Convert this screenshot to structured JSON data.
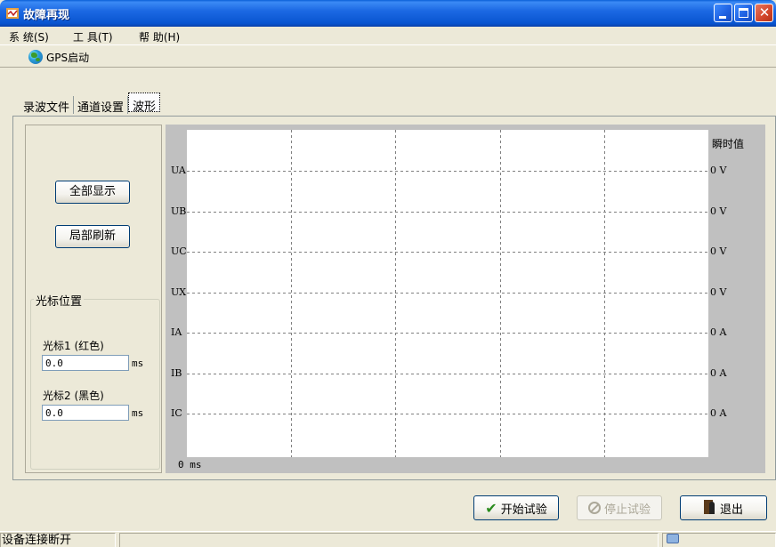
{
  "window": {
    "title": "故障再现",
    "min_label": "",
    "max_label": "",
    "close_label": "✕"
  },
  "menu": {
    "items": [
      "系 统(S)",
      "工 具(T)",
      "帮 助(H)"
    ]
  },
  "toolbar": {
    "gps_label": "GPS启动"
  },
  "tabs": [
    "录波文件",
    "通道设置",
    "波形"
  ],
  "left": {
    "show_all": "全部显示",
    "refresh": "局部刷新",
    "cursor_group": "光标位置",
    "cursor1_label": "光标1 (红色)",
    "cursor1_value": "0.0",
    "cursor2_label": "光标2 (黑色)",
    "cursor2_value": "0.0",
    "unit": "ms"
  },
  "chart_data": {
    "type": "line",
    "channels": [
      "UA",
      "UB",
      "UC",
      "UX",
      "IA",
      "IB",
      "IC"
    ],
    "values": [
      "0 V",
      "0 V",
      "0 V",
      "0 V",
      "0 A",
      "0 A",
      "0 A"
    ],
    "value_header": "瞬时值",
    "x_start_label": "0 ms"
  },
  "buttons": {
    "start": "开始试验",
    "stop": "停止试验",
    "exit": "退出"
  },
  "status": {
    "connection": "设备连接断开"
  },
  "colors": {
    "title_bar": "#0a5fd8",
    "plot_bg": "#ffffff",
    "chart_frame": "#c0c0c0"
  }
}
